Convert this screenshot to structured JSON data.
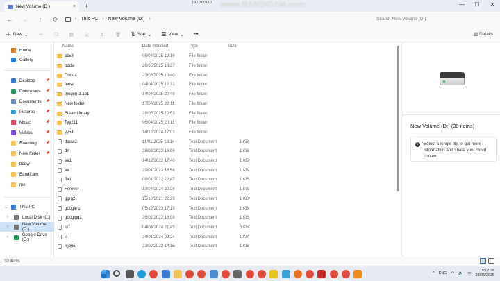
{
  "window": {
    "tab_title": "New Volume (D:)",
    "tab_close": "×",
    "new_tab": "+",
    "watermark": "www.BANDICAM.com",
    "recording_res": "1920x1080",
    "controls": [
      "—",
      "☐",
      "✕"
    ]
  },
  "nav": {
    "back": "←",
    "forward": "→",
    "up": "↑",
    "refresh": "⟳",
    "breadcrumb": [
      "This PC",
      "New Volume (D:)"
    ],
    "separator": "›",
    "search_placeholder": "Search New Volume (D:)"
  },
  "toolbar": {
    "new_label": "New",
    "sort_label": "Sort",
    "view_label": "View",
    "more_label": "•••",
    "details_label": "Details"
  },
  "sidebar": {
    "items": [
      {
        "label": "Home",
        "color": "#d9822b",
        "pinned": false
      },
      {
        "label": "Gallery",
        "color": "#2b82d9",
        "pinned": false
      },
      {
        "label": "Desktop",
        "color": "#3a7bd5",
        "pinned": true
      },
      {
        "label": "Downloads",
        "color": "#2b9a5e",
        "pinned": true
      },
      {
        "label": "Documents",
        "color": "#6b8bb5",
        "pinned": true
      },
      {
        "label": "Pictures",
        "color": "#3a9ad5",
        "pinned": true
      },
      {
        "label": "Music",
        "color": "#d94b6b",
        "pinned": true
      },
      {
        "label": "Videos",
        "color": "#7a4bd5",
        "pinned": true
      },
      {
        "label": "Roaming",
        "color": "#f2c55c",
        "pinned": true
      },
      {
        "label": "New folder",
        "color": "#f2c55c",
        "pinned": true
      },
      {
        "label": "bddw",
        "color": "#f2c55c",
        "pinned": false
      },
      {
        "label": "Bandicam",
        "color": "#f2c55c",
        "pinned": false
      },
      {
        "label": "me",
        "color": "#f2c55c",
        "pinned": false
      }
    ],
    "drives": [
      {
        "label": "This PC",
        "color": "#3a7bd5",
        "chev": "⌄"
      },
      {
        "label": "Local Disk (C:)",
        "color": "#777777",
        "chev": "›"
      },
      {
        "label": "New Volume (D:)",
        "color": "#777777",
        "chev": "›"
      },
      {
        "label": "Google Drive (G:)",
        "color": "#2b9a5e",
        "chev": "›"
      }
    ]
  },
  "columns": {
    "name": "Name",
    "date": "Date modified",
    "type": "Type",
    "size": "Size"
  },
  "files": [
    {
      "name": "aax3",
      "date": "05/04/2025 12:16",
      "type": "File folder",
      "size": "",
      "kind": "folder"
    },
    {
      "name": "bddw",
      "date": "26/05/2025 16:27",
      "type": "File folder",
      "size": "",
      "kind": "folder"
    },
    {
      "name": "Doooa",
      "date": "23/05/2025 10:40",
      "type": "File folder",
      "size": "",
      "kind": "folder"
    },
    {
      "name": "feew",
      "date": "04/04/2025 12:31",
      "type": "File folder",
      "size": "",
      "kind": "folder"
    },
    {
      "name": "mugen-1.1b1",
      "date": "14/04/2025 20:48",
      "type": "File folder",
      "size": "",
      "kind": "folder"
    },
    {
      "name": "New folder",
      "date": "17/04/2025 22:11",
      "type": "File folder",
      "size": "",
      "kind": "folder"
    },
    {
      "name": "SteamLibrary",
      "date": "28/05/2025 10:53",
      "type": "File folder",
      "size": "",
      "kind": "folder"
    },
    {
      "name": "Tyy211",
      "date": "06/04/2025 20:11",
      "type": "File folder",
      "size": "",
      "kind": "folder"
    },
    {
      "name": "yy54",
      "date": "14/12/2024 17:01",
      "type": "File folder",
      "size": "",
      "kind": "folder"
    },
    {
      "name": "daaw2",
      "date": "11/01/2025 18:14",
      "type": "Text Document",
      "size": "1 KB",
      "kind": "doc"
    },
    {
      "name": "drr",
      "date": "28/03/2022 16:06",
      "type": "Text Document",
      "size": "1 KB",
      "kind": "doc"
    },
    {
      "name": "ea1",
      "date": "14/12/2022 17:40",
      "type": "Text Document",
      "size": "1 KB",
      "kind": "doc"
    },
    {
      "name": "ee",
      "date": "29/01/2023 16:56",
      "type": "Text Document",
      "size": "1 KB",
      "kind": "doc"
    },
    {
      "name": "ffa1",
      "date": "08/01/2022 22:47",
      "type": "Text Document",
      "size": "1 KB",
      "kind": "doc"
    },
    {
      "name": "Forever",
      "date": "13/04/2024 20:28",
      "type": "Text Document",
      "size": "1 KB",
      "kind": "doc"
    },
    {
      "name": "ggrg2",
      "date": "15/10/2021 22:29",
      "type": "Text Document",
      "size": "1 KB",
      "kind": "doc"
    },
    {
      "name": "google z",
      "date": "05/12/2023 17:19",
      "type": "Text Document",
      "size": "1 KB",
      "kind": "doc"
    },
    {
      "name": "googlgg2",
      "date": "26/02/2022 16:08",
      "type": "Text Document",
      "size": "1 KB",
      "kind": "doc"
    },
    {
      "name": "iu7",
      "date": "04/04/2024 21:45",
      "type": "Text Document",
      "size": "6 KB",
      "kind": "doc"
    },
    {
      "name": "ki",
      "date": "24/01/2024 09:24",
      "type": "Text Document",
      "size": "1 KB",
      "kind": "doc"
    },
    {
      "name": "lkjb65",
      "date": "23/02/2022 14:15",
      "type": "Text Document",
      "size": "1 KB",
      "kind": "doc"
    }
  ],
  "details_panel": {
    "title": "New Volume (D:) (30 items)",
    "info": "Select a single file to get more information and share your cloud content.",
    "info_icon": "i"
  },
  "status": {
    "items": "30 items"
  },
  "taskbar": {
    "icons": [
      {
        "name": "start-icon",
        "color": "#2d7dd2"
      },
      {
        "name": "search-icon",
        "color": "#444444"
      },
      {
        "name": "task-view-icon",
        "color": "#555555"
      },
      {
        "name": "edge-icon",
        "color": "#1f9bd7"
      },
      {
        "name": "chrome-icon",
        "color": "#e04a3a"
      },
      {
        "name": "store-icon",
        "color": "#3a7bd5"
      },
      {
        "name": "explorer-icon",
        "color": "#f2c55c"
      },
      {
        "name": "chrome-icon",
        "color": "#e04a3a"
      },
      {
        "name": "chrome-icon",
        "color": "#e04a3a"
      },
      {
        "name": "app-icon",
        "color": "#4a8fd0"
      },
      {
        "name": "chrome-icon",
        "color": "#e04a3a"
      },
      {
        "name": "app-icon",
        "color": "#666666"
      },
      {
        "name": "chrome-icon",
        "color": "#e04a3a"
      },
      {
        "name": "chrome-icon",
        "color": "#e04a3a"
      },
      {
        "name": "app-icon",
        "color": "#e8c21c"
      },
      {
        "name": "app-icon",
        "color": "#3aa0d5"
      },
      {
        "name": "firefox-icon",
        "color": "#e8701c"
      },
      {
        "name": "chrome-icon",
        "color": "#e04a3a"
      },
      {
        "name": "app-icon",
        "color": "#c22a2a"
      },
      {
        "name": "chrome-icon",
        "color": "#e04a3a"
      },
      {
        "name": "chrome-icon",
        "color": "#e04a3a"
      },
      {
        "name": "vlc-icon",
        "color": "#f08a1c"
      }
    ],
    "tray_arrow": "^",
    "lang": "ENG",
    "time": "19:12:38",
    "date": "28/05/2025"
  }
}
